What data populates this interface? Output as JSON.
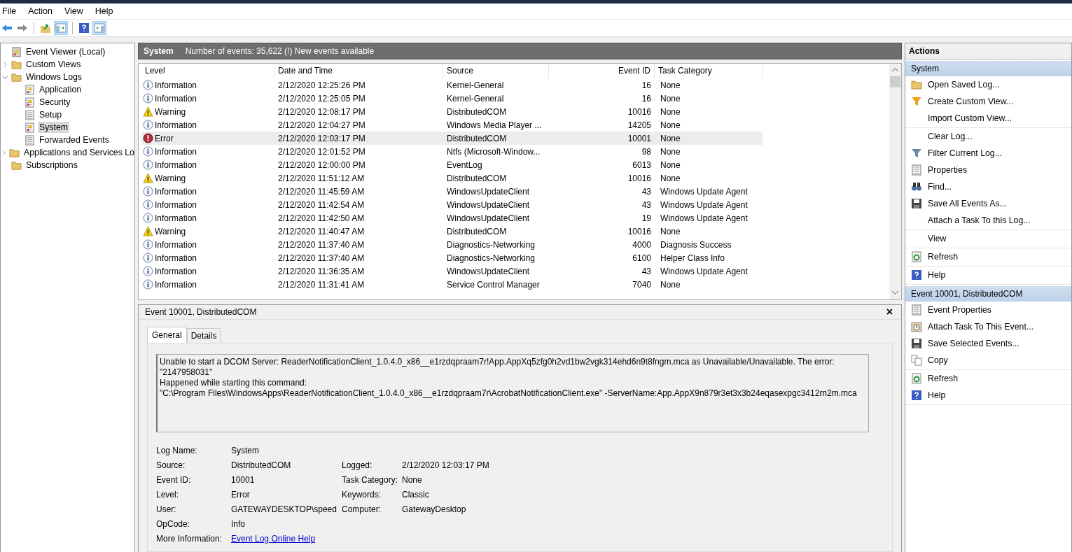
{
  "menu": [
    "File",
    "Action",
    "View",
    "Help"
  ],
  "toolbar": [
    {
      "kind": "back",
      "pressed": false
    },
    {
      "kind": "forward",
      "pressed": false
    },
    {
      "kind": "up",
      "pressed": false
    },
    {
      "kind": "tree",
      "pressed": true
    },
    {
      "kind": "help",
      "pressed": false
    },
    {
      "kind": "pane",
      "pressed": true
    }
  ],
  "tree": [
    {
      "label": "Event Viewer (Local)",
      "kind": "root",
      "selected": false,
      "children": [
        {
          "label": "Custom Views",
          "kind": "folder",
          "selected": false,
          "expanded": false
        },
        {
          "label": "Windows Logs",
          "kind": "folder",
          "selected": false,
          "expanded": true,
          "children": [
            {
              "label": "Application",
              "kind": "log",
              "selected": false
            },
            {
              "label": "Security",
              "kind": "log",
              "selected": false
            },
            {
              "label": "Setup",
              "kind": "sheet",
              "selected": false
            },
            {
              "label": "System",
              "kind": "log",
              "selected": true
            },
            {
              "label": "Forwarded Events",
              "kind": "sheet",
              "selected": false
            }
          ]
        },
        {
          "label": "Applications and Services Lo",
          "kind": "folder",
          "selected": false,
          "expanded": false
        },
        {
          "label": "Subscriptions",
          "kind": "folder",
          "selected": false
        }
      ]
    }
  ],
  "log_header": {
    "title": "System",
    "summary": "Number of events: 35,622 (!) New events available"
  },
  "table": {
    "columns": [
      "Level",
      "Date and Time",
      "Source",
      "Event ID",
      "Task Category"
    ],
    "rows": [
      {
        "kind": "info",
        "level": "Information",
        "date": "2/12/2020 12:25:26 PM",
        "source": "Kernel-General",
        "event_id": "16",
        "task": "None",
        "selected": false
      },
      {
        "kind": "info",
        "level": "Information",
        "date": "2/12/2020 12:25:05 PM",
        "source": "Kernel-General",
        "event_id": "16",
        "task": "None",
        "selected": false
      },
      {
        "kind": "warning",
        "level": "Warning",
        "date": "2/12/2020 12:08:17 PM",
        "source": "DistributedCOM",
        "event_id": "10016",
        "task": "None",
        "selected": false
      },
      {
        "kind": "info",
        "level": "Information",
        "date": "2/12/2020 12:04:27 PM",
        "source": "Windows Media Player ...",
        "event_id": "14205",
        "task": "None",
        "selected": false
      },
      {
        "kind": "error",
        "level": "Error",
        "date": "2/12/2020 12:03:17 PM",
        "source": "DistributedCOM",
        "event_id": "10001",
        "task": "None",
        "selected": true
      },
      {
        "kind": "info",
        "level": "Information",
        "date": "2/12/2020 12:01:52 PM",
        "source": "Ntfs (Microsoft-Window...",
        "event_id": "98",
        "task": "None",
        "selected": false
      },
      {
        "kind": "info",
        "level": "Information",
        "date": "2/12/2020 12:00:00 PM",
        "source": "EventLog",
        "event_id": "6013",
        "task": "None",
        "selected": false
      },
      {
        "kind": "warning",
        "level": "Warning",
        "date": "2/12/2020 11:51:12 AM",
        "source": "DistributedCOM",
        "event_id": "10016",
        "task": "None",
        "selected": false
      },
      {
        "kind": "info",
        "level": "Information",
        "date": "2/12/2020 11:45:59 AM",
        "source": "WindowsUpdateClient",
        "event_id": "43",
        "task": "Windows Update Agent",
        "selected": false
      },
      {
        "kind": "info",
        "level": "Information",
        "date": "2/12/2020 11:42:54 AM",
        "source": "WindowsUpdateClient",
        "event_id": "43",
        "task": "Windows Update Agent",
        "selected": false
      },
      {
        "kind": "info",
        "level": "Information",
        "date": "2/12/2020 11:42:50 AM",
        "source": "WindowsUpdateClient",
        "event_id": "19",
        "task": "Windows Update Agent",
        "selected": false
      },
      {
        "kind": "warning",
        "level": "Warning",
        "date": "2/12/2020 11:40:47 AM",
        "source": "DistributedCOM",
        "event_id": "10016",
        "task": "None",
        "selected": false
      },
      {
        "kind": "info",
        "level": "Information",
        "date": "2/12/2020 11:37:40 AM",
        "source": "Diagnostics-Networking",
        "event_id": "4000",
        "task": "Diagnosis Success",
        "selected": false
      },
      {
        "kind": "info",
        "level": "Information",
        "date": "2/12/2020 11:37:40 AM",
        "source": "Diagnostics-Networking",
        "event_id": "6100",
        "task": "Helper Class Info",
        "selected": false
      },
      {
        "kind": "info",
        "level": "Information",
        "date": "2/12/2020 11:36:35 AM",
        "source": "WindowsUpdateClient",
        "event_id": "43",
        "task": "Windows Update Agent",
        "selected": false
      },
      {
        "kind": "info",
        "level": "Information",
        "date": "2/12/2020 11:31:41 AM",
        "source": "Service Control Manager",
        "event_id": "7040",
        "task": "None",
        "selected": false
      }
    ]
  },
  "detail": {
    "title": "Event 10001, DistributedCOM",
    "close": "×",
    "tabs": [
      {
        "label": "General",
        "selected": true
      },
      {
        "label": "Details",
        "selected": false
      }
    ],
    "message": [
      "Unable to start a DCOM Server: ReaderNotificationClient_1.0.4.0_x86__e1rzdqpraam7r!App.AppXq5zfg0h2vd1bw2vgk314ehd6n9t8fngm.mca as Unavailable/Unavailable. The error:",
      "\"2147958031\"",
      "Happened while starting this command:",
      "\"C:\\Program Files\\WindowsApps\\ReaderNotificationClient_1.0.4.0_x86__e1rzdqpraam7r\\AcrobatNotificationClient.exe\" -ServerName:App.AppX9n879r3et3x3b24eqasexpgc3412rn2m.mca"
    ],
    "properties": [
      {
        "label": "Log Name:",
        "value": "System"
      },
      {
        "label": "Source:",
        "value": "DistributedCOM",
        "right_label": "Logged:",
        "right_value": "2/12/2020 12:03:17 PM"
      },
      {
        "label": "Event ID:",
        "value": "10001",
        "right_label": "Task Category:",
        "right_value": "None"
      },
      {
        "label": "Level:",
        "value": "Error",
        "right_label": "Keywords:",
        "right_value": "Classic"
      },
      {
        "label": "User:",
        "value": "GATEWAYDESKTOP\\speed",
        "right_label": "Computer:",
        "right_value": "GatewayDesktop"
      },
      {
        "label": "OpCode:",
        "value": "Info"
      }
    ],
    "more_info": {
      "label": "More Information:",
      "link": "Event Log Online Help"
    }
  },
  "actions": {
    "title": "Actions",
    "sections": [
      {
        "title": "System",
        "groups": [
          [
            {
              "label": "Open Saved Log...",
              "kind": "folder"
            },
            {
              "label": "Create Custom View...",
              "kind": "funnel"
            },
            {
              "label": "Import Custom View...",
              "kind": "none"
            }
          ],
          [
            {
              "label": "Clear Log...",
              "kind": "none"
            },
            {
              "label": "Filter Current Log...",
              "kind": "filter"
            },
            {
              "label": "Properties",
              "kind": "sheet"
            },
            {
              "label": "Find...",
              "kind": "binoculars"
            },
            {
              "label": "Save All Events As...",
              "kind": "disk"
            },
            {
              "label": "Attach a Task To this Log...",
              "kind": "none"
            }
          ],
          [
            {
              "label": "View",
              "kind": "none"
            }
          ],
          [
            {
              "label": "Refresh",
              "kind": "refresh"
            }
          ],
          [
            {
              "label": "Help",
              "kind": "help"
            }
          ]
        ]
      },
      {
        "title": "Event 10001, DistributedCOM",
        "groups": [
          [
            {
              "label": "Event Properties",
              "kind": "sheet"
            },
            {
              "label": "Attach Task To This Event...",
              "kind": "clock"
            },
            {
              "label": "Save Selected Events...",
              "kind": "disk"
            },
            {
              "label": "Copy",
              "kind": "copy"
            }
          ],
          [
            {
              "label": "Refresh",
              "kind": "refresh"
            },
            {
              "label": "Help",
              "kind": "help"
            }
          ]
        ]
      }
    ]
  }
}
